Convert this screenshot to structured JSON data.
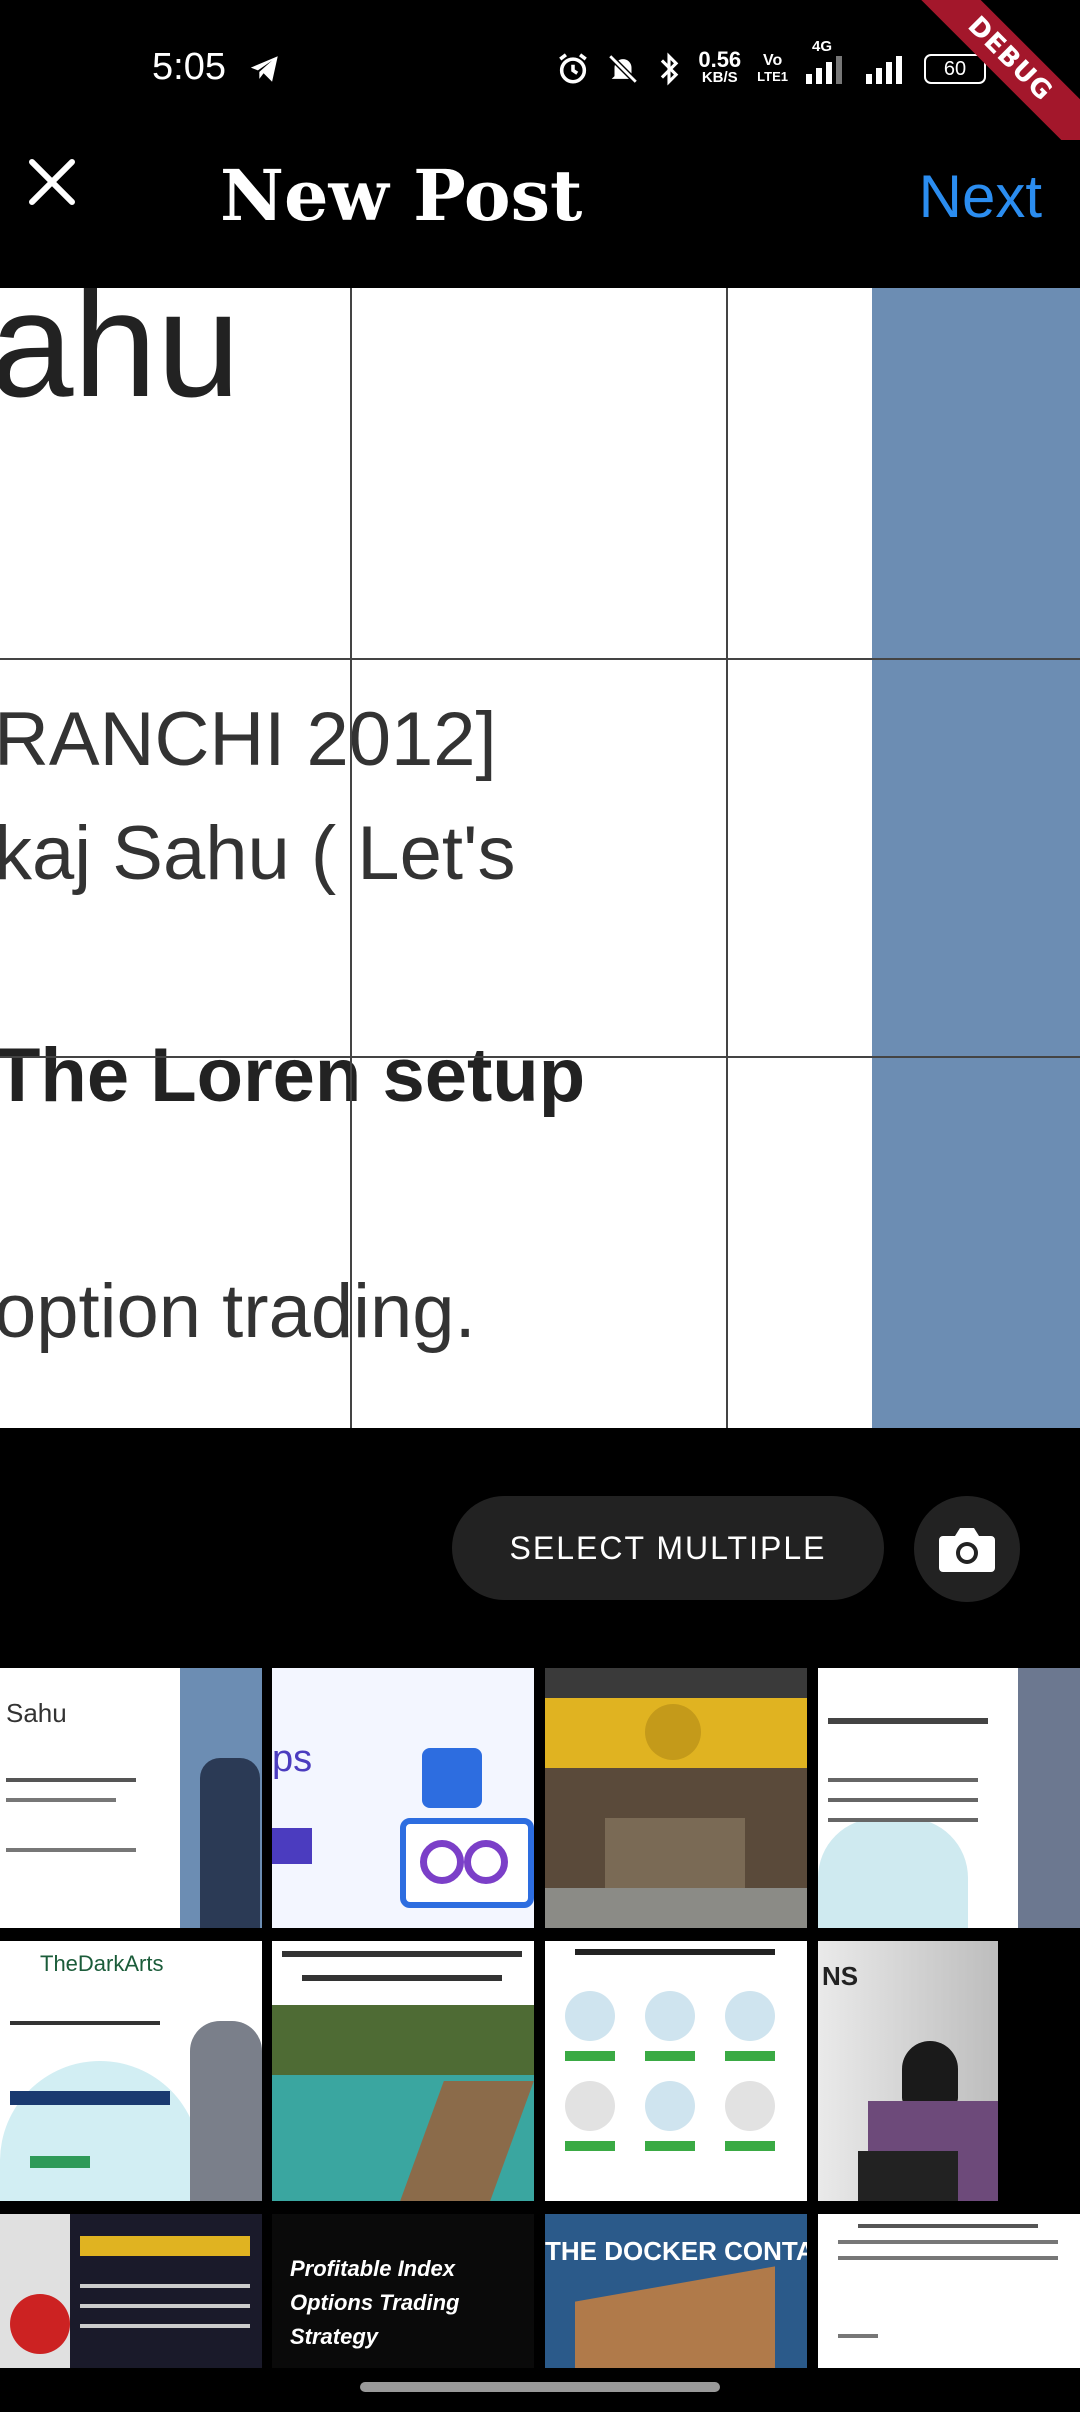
{
  "status_bar": {
    "time": "5:05",
    "net_speed_value": "0.56",
    "net_speed_unit": "KB/S",
    "volte_top": "Vo",
    "volte_bottom": "LTE1",
    "network": "4G",
    "battery": "60",
    "debug_label": "DEBUG"
  },
  "header": {
    "title": "New Post",
    "next_label": "Next"
  },
  "preview": {
    "line_1": "ahu",
    "line_2": "RANCHI 2012]",
    "line_3": "kaj Sahu ( Let's",
    "line_4": "The Loren setup",
    "line_5": "option trading."
  },
  "controls": {
    "select_multiple_label": "SELECT MULTIPLE"
  },
  "gallery": {
    "thumbs": [
      {
        "caption": "Sahu"
      },
      {
        "caption": "ps"
      },
      {
        "caption": ""
      },
      {
        "caption": ""
      },
      {
        "caption": "TheDarkArts"
      },
      {
        "caption": ""
      },
      {
        "caption": ""
      },
      {
        "caption": "NS"
      },
      {
        "caption": ""
      },
      {
        "caption": "Profitable Index Options Trading Strategy"
      },
      {
        "caption": "THE DOCKER CONTAINER"
      },
      {
        "caption": ""
      }
    ]
  },
  "colors": {
    "accent": "#2b8df0",
    "background": "#000000",
    "debug_banner": "#a3172b"
  }
}
